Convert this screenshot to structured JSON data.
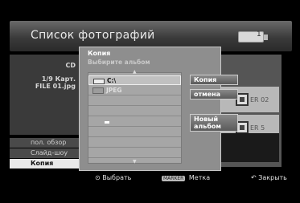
{
  "header": {
    "title": "Список фотографий",
    "indicator": "1"
  },
  "info": {
    "cd": "CD",
    "card": "1/9 Карт.",
    "file": "FILE 01.jpg"
  },
  "menu": [
    {
      "label": "пол. обзор",
      "active": false
    },
    {
      "label": "Слайд-шоу",
      "active": false
    },
    {
      "label": "Копия",
      "active": true
    }
  ],
  "thumbs": [
    {
      "label": "ER 02"
    },
    {
      "label": "ER 5"
    }
  ],
  "dialog": {
    "title": "Копия",
    "prompt": "Выбирите альбом",
    "rows": [
      {
        "label": "C:\\",
        "icon": "drive-icon"
      },
      {
        "label": "JPEG",
        "icon": "folder-icon"
      }
    ],
    "buttons": {
      "copy": "Копия",
      "cancel": "отмена",
      "new_album_1": "Новый",
      "new_album_2": "альбом"
    }
  },
  "bottom": {
    "select": "Выбрать",
    "marker_btn": "MARKER",
    "mark": "Метка",
    "close": "Закрыть"
  }
}
